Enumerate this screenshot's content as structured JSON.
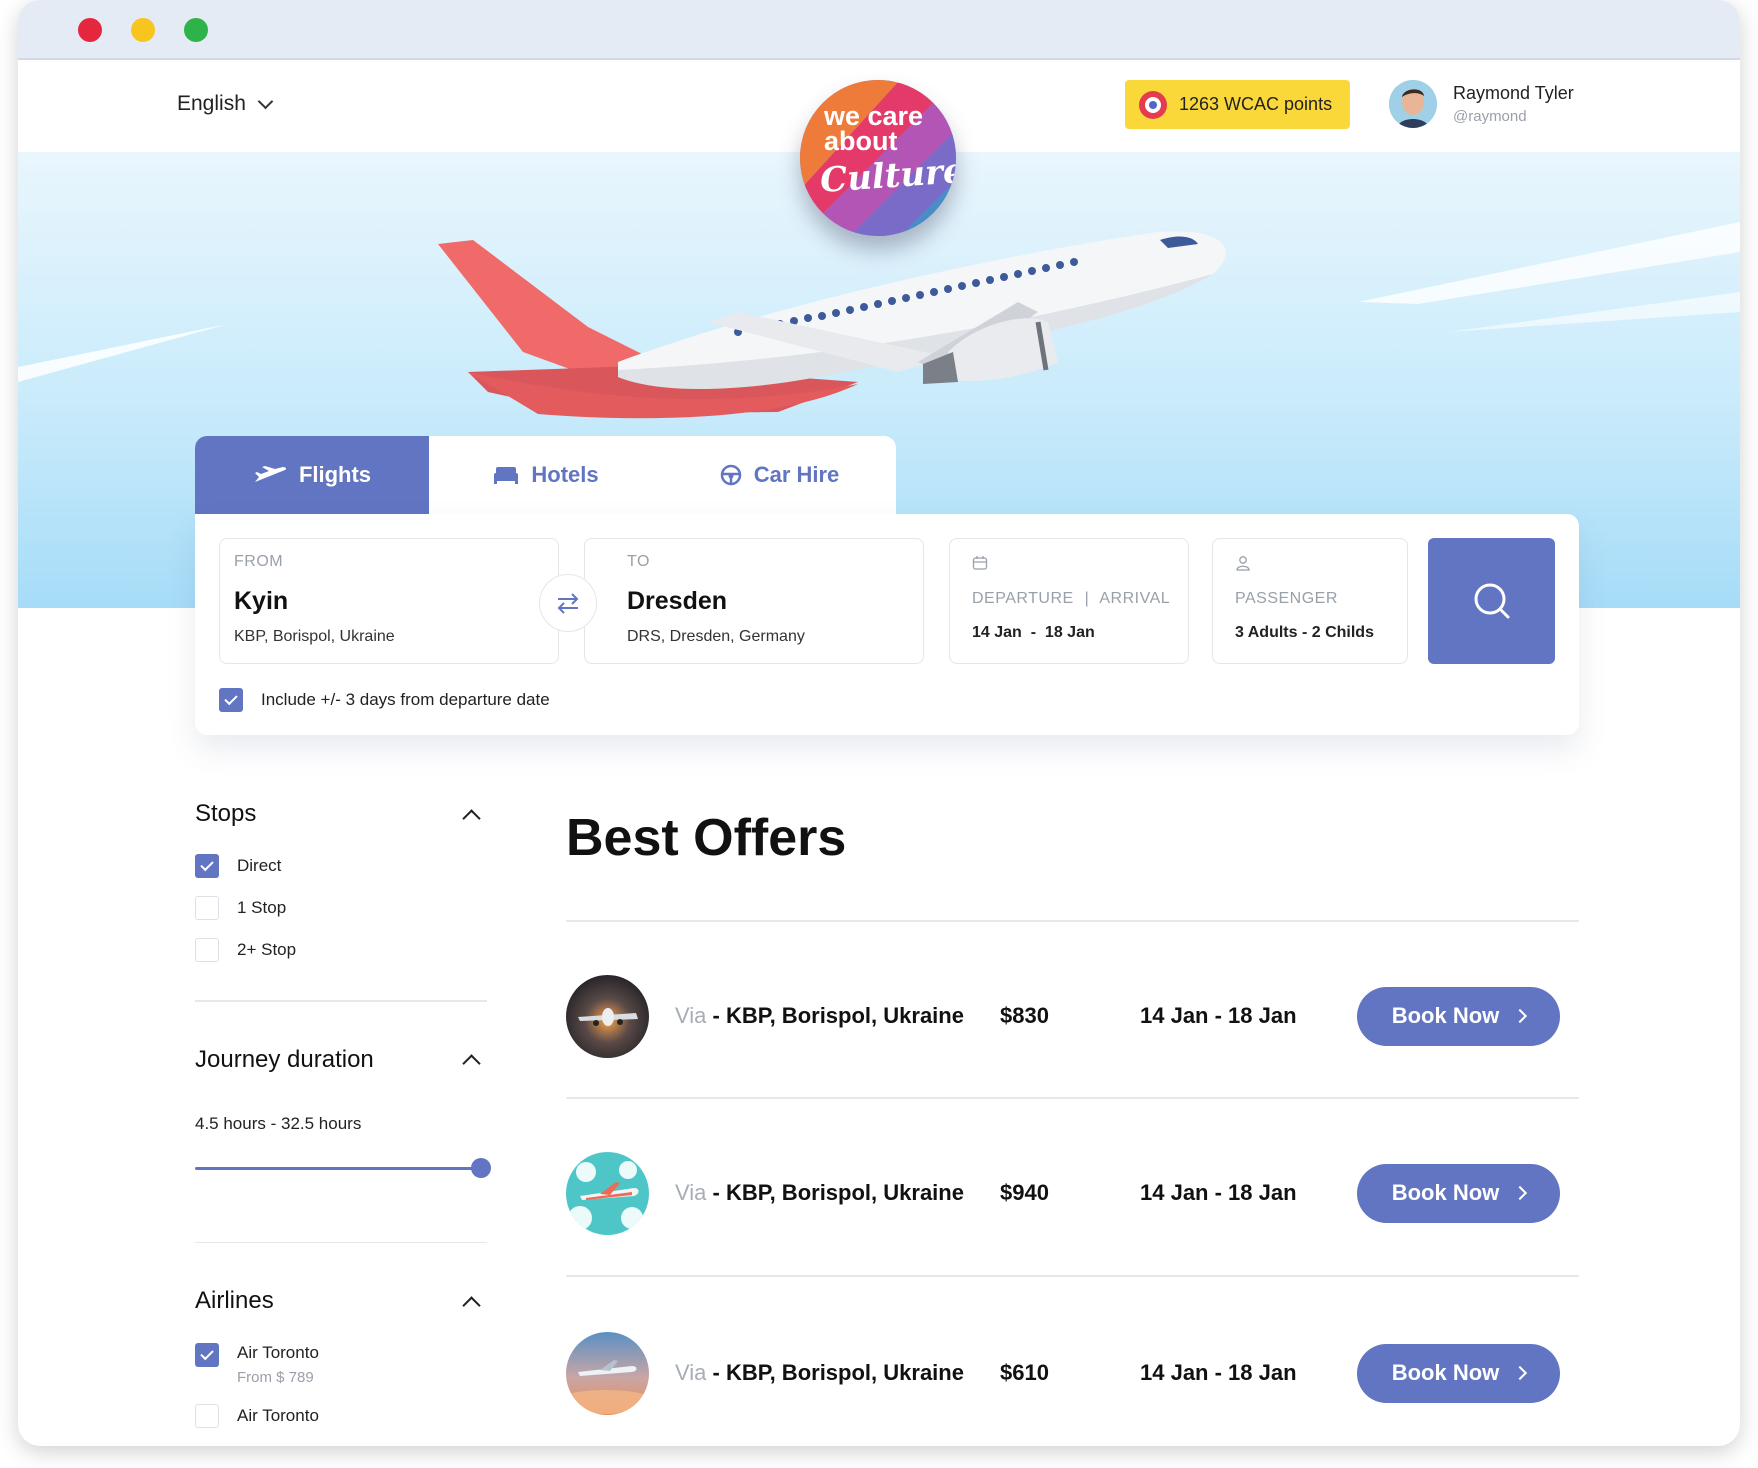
{
  "window": {
    "dots": [
      "#e5273e",
      "#f6c51e",
      "#2db34a"
    ]
  },
  "header": {
    "language": "English",
    "logo": {
      "line1": "we care",
      "line2": "about",
      "script": "Culture"
    },
    "points": "1263 WCAC points",
    "user": {
      "name": "Raymond Tyler",
      "handle": "@raymond"
    }
  },
  "tabs": [
    {
      "label": "Flights",
      "icon": "plane-icon",
      "active": true
    },
    {
      "label": "Hotels",
      "icon": "bed-icon",
      "active": false
    },
    {
      "label": "Car Hire",
      "icon": "steering-wheel-icon",
      "active": false
    }
  ],
  "search": {
    "from": {
      "label": "FROM",
      "city": "Kyin",
      "detail": "KBP, Borispol, Ukraine"
    },
    "to": {
      "label": "TO",
      "city": "Dresden",
      "detail": "DRS, Dresden, Germany"
    },
    "dates": {
      "departure_label": "DEPARTURE",
      "separator": "|",
      "arrival_label": "ARRIVAL",
      "value": "14 Jan  -  18 Jan"
    },
    "passenger": {
      "label": "PASSENGER",
      "value": "3 Adults - 2 Childs"
    },
    "include_days": {
      "label": "Include +/- 3 days from departure date",
      "checked": true
    }
  },
  "filters": {
    "stops": {
      "title": "Stops",
      "options": [
        {
          "label": "Direct",
          "checked": true
        },
        {
          "label": "1 Stop",
          "checked": false
        },
        {
          "label": "2+ Stop",
          "checked": false
        }
      ]
    },
    "journey": {
      "title": "Journey duration",
      "range": "4.5 hours - 32.5 hours",
      "slider_level": 1.0
    },
    "airlines": {
      "title": "Airlines",
      "options": [
        {
          "label": "Air Toronto",
          "sub": "From $ 789",
          "checked": true
        },
        {
          "label": "Air Toronto",
          "sub": "",
          "checked": false
        }
      ]
    }
  },
  "offers": {
    "title": "Best Offers",
    "items": [
      {
        "via_prefix": "Via",
        "via": "- KBP, Borispol, Ukraine",
        "price": "$830",
        "dates": "14 Jan - 18 Jan",
        "button": "Book Now"
      },
      {
        "via_prefix": "Via",
        "via": "- KBP, Borispol, Ukraine",
        "price": "$940",
        "dates": "14 Jan - 18 Jan",
        "button": "Book Now"
      },
      {
        "via_prefix": "Via",
        "via": "- KBP, Borispol, Ukraine",
        "price": "$610",
        "dates": "14 Jan - 18 Jan",
        "button": "Book Now"
      }
    ]
  },
  "colors": {
    "accent": "#6175c2",
    "points_bg": "#fbd83a",
    "sky": "#a6dcf8"
  }
}
